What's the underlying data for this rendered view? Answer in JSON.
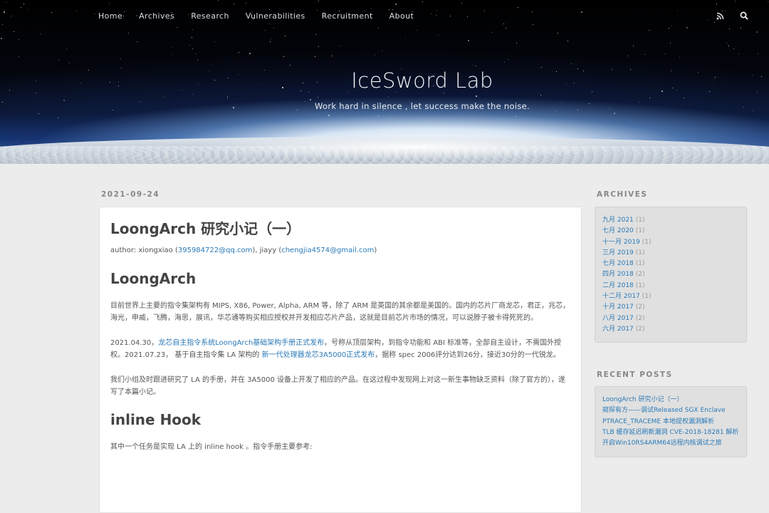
{
  "nav": {
    "items": [
      "Home",
      "Archives",
      "Research",
      "Vulnerabilities",
      "Recruitment",
      "About"
    ],
    "icons": [
      "rss-icon",
      "search-icon"
    ]
  },
  "site": {
    "title": "IceSword Lab",
    "subtitle": "Work hard in silence , let success make the noise."
  },
  "post": {
    "date": "2021-09-24",
    "title": "LoongArch 研究小记（一）",
    "author_prefix": "author: xiongxiao (",
    "author_email1": "395984722@qq.com",
    "author_mid": "), jiayy (",
    "author_email2": "chengjia4574@gmail.com",
    "author_suffix": ")",
    "h2_1": "LoongArch",
    "p1": "目前世界上主要的指令集架构有 MIPS, X86, Power, Alpha, ARM 等，除了 ARM 是英国的其余都是美国的。国内的芯片厂商龙芯，君正，兆芯，海光，申威，飞腾，海思，展讯，华芯通等购买相应授权并开发相应芯片产品，这就是目前芯片市场的情况，可以说脖子被卡得死死的。",
    "p2_a": "2021.04.30，",
    "p2_link1": "龙芯自主指令系统LoongArch基础架构手册正式发布",
    "p2_b": "，号称从顶层架构，到指令功能和 ABI 标准等，全部自主设计，不需国外授权。2021.07.23， 基于自主指令集 LA 架构的",
    "p2_link2": "新一代处理器龙芯3A5000正式发布",
    "p2_c": "，据称 spec 2006评分达到26分，接近30分的一代锐龙。",
    "p3": "我们小组及时跟进研究了 LA 的手册，并在 3A5000 设备上开发了相应的产品。在这过程中发现网上对这一新生事物缺乏资料（除了官方的），遂写了本篇小记。",
    "h2_2": "inline Hook",
    "p4": "其中一个任务是实现 LA 上的 inline hook 。指令手册主要参考:"
  },
  "sidebar": {
    "archives_title": "ARCHIVES",
    "archives": [
      {
        "label": "九月 2021",
        "count": "(1)"
      },
      {
        "label": "七月 2020",
        "count": "(1)"
      },
      {
        "label": "十一月 2019",
        "count": "(1)"
      },
      {
        "label": "三月 2019",
        "count": "(1)"
      },
      {
        "label": "七月 2018",
        "count": "(1)"
      },
      {
        "label": "四月 2018",
        "count": "(2)"
      },
      {
        "label": "二月 2018",
        "count": "(1)"
      },
      {
        "label": "十二月 2017",
        "count": "(1)"
      },
      {
        "label": "十月 2017",
        "count": "(2)"
      },
      {
        "label": "八月 2017",
        "count": "(2)"
      },
      {
        "label": "六月 2017",
        "count": "(2)"
      }
    ],
    "recent_title": "RECENT POSTS",
    "recent": [
      "LoongArch 研究小记（一）",
      "窥探有方——调试Released SGX Enclave",
      "PTRACE_TRACEME 本地提权漏洞解析",
      "TLB 缓存延迟刷新漏洞 CVE-2018-18281 解析",
      "开启Win10RS4ARM64远程内核调试之旅"
    ]
  }
}
